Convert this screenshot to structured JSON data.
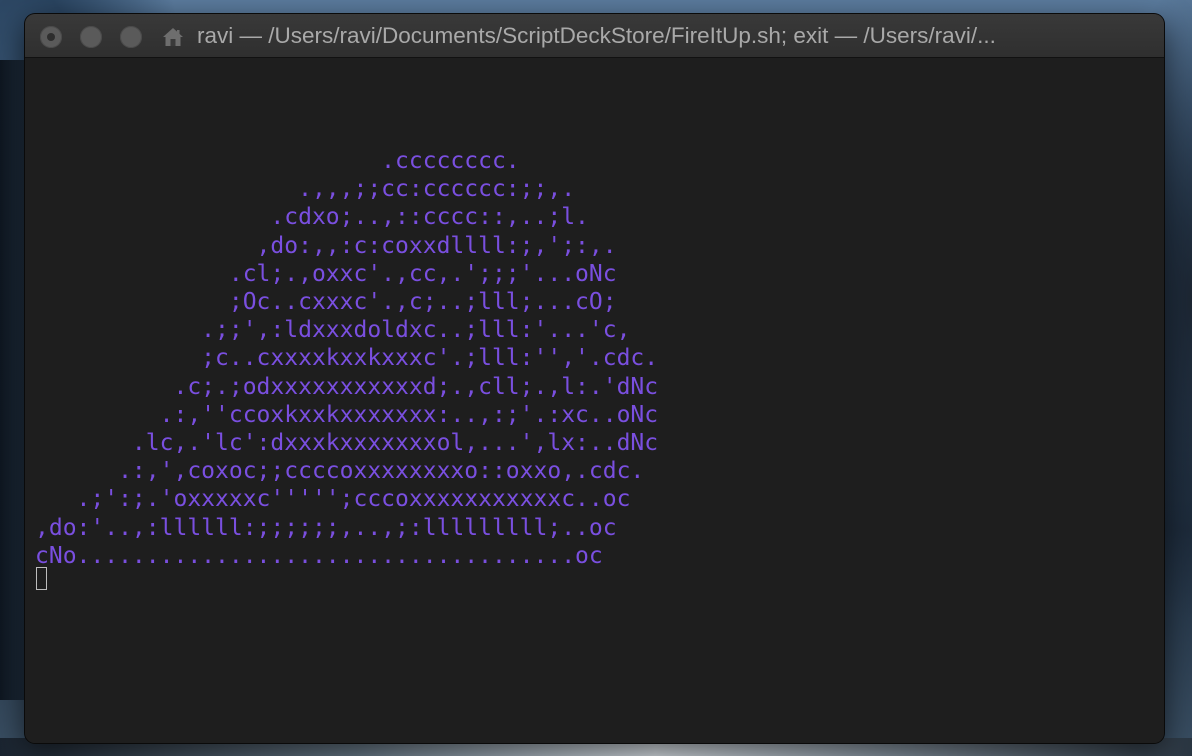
{
  "window": {
    "title": "ravi — /Users/ravi/Documents/ScriptDeckStore/FireItUp.sh; exit — /Users/ravi/..."
  },
  "terminal": {
    "text_color": "#7a4fe0",
    "background": "#1e1e1e",
    "lines": [
      "                         .cccccccc.",
      "                   .,,,;;cc:cccccc:;;,.",
      "                 .cdxo;..,::cccc::,..;l.",
      "                ,do:,,:c:coxxdllll:;,';:,.",
      "              .cl;.,oxxc'.,cc,.';;;'...oNc",
      "              ;Oc..cxxxc'.,c;..;lll;...cO;",
      "            .;;',:ldxxxdoldxc..;lll:'...'c,",
      "            ;c..cxxxxkxxkxxxc'.;lll:'','.cdc.",
      "          .c;.;odxxxxxxxxxxxd;.,cll;.,l:.'dNc",
      "         .:,''ccoxkxxkxxxxxxx:..,:;'.:xc..oNc",
      "       .lc,.'lc':dxxxkxxxxxxxol,...',lx:..dNc",
      "      .:,',coxoc;;ccccoxxxxxxxxo::oxxo,.cdc.",
      "   .;':;.'oxxxxxc''''';cccoxxxxxxxxxxxc..oc",
      ",do:'..,:llllll:;;;;;;,..,;:lllllllll;..oc",
      "cNo....................................oc"
    ]
  }
}
